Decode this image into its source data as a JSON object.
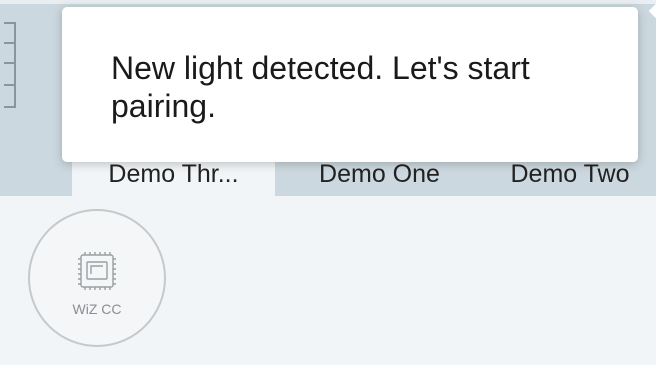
{
  "toast": {
    "message": "New light detected. Let's start pairing."
  },
  "tabs": [
    {
      "label": "Demo Thr...",
      "active": true
    },
    {
      "label": "Demo One",
      "active": false
    },
    {
      "label": "Demo Two",
      "active": false
    }
  ],
  "devices": [
    {
      "label": "WiZ CC",
      "icon": "chip-icon"
    }
  ],
  "colors": {
    "header_bg": "#ccd8df",
    "content_bg": "#f2f5f7",
    "toast_bg": "#ffffff",
    "text": "#222222"
  }
}
